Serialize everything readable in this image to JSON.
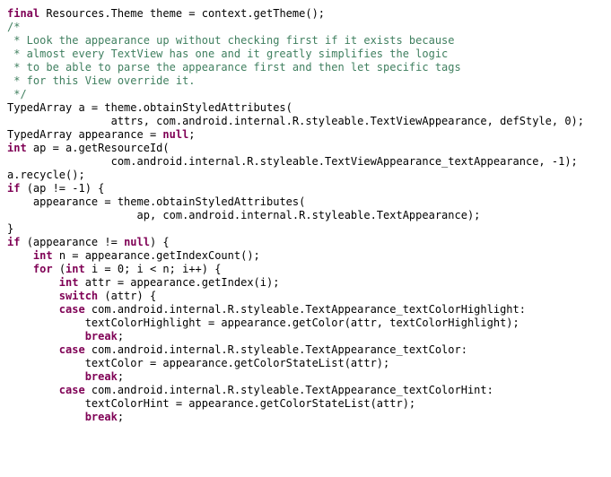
{
  "lines": [
    {
      "indent": 0,
      "parts": [
        {
          "t": "final ",
          "c": "kw"
        },
        {
          "t": "Resources.Theme theme = context.getTheme();"
        }
      ]
    },
    {
      "indent": 0,
      "parts": [
        {
          "t": ""
        }
      ]
    },
    {
      "indent": 0,
      "parts": [
        {
          "t": "/*",
          "c": "cmt"
        }
      ]
    },
    {
      "indent": 0,
      "parts": [
        {
          "t": " * Look the appearance up without checking first if it exists because",
          "c": "cmt"
        }
      ]
    },
    {
      "indent": 0,
      "parts": [
        {
          "t": " * almost every TextView has one and it greatly simplifies the logic",
          "c": "cmt"
        }
      ]
    },
    {
      "indent": 0,
      "parts": [
        {
          "t": " * to be able to parse the appearance first and then let specific tags",
          "c": "cmt"
        }
      ]
    },
    {
      "indent": 0,
      "parts": [
        {
          "t": " * for this View override it.",
          "c": "cmt"
        }
      ]
    },
    {
      "indent": 0,
      "parts": [
        {
          "t": " */",
          "c": "cmt"
        }
      ]
    },
    {
      "indent": 0,
      "parts": [
        {
          "t": "TypedArray a = theme.obtainStyledAttributes("
        }
      ]
    },
    {
      "indent": 16,
      "parts": [
        {
          "t": "attrs, com.android.internal.R.styleable.TextViewAppearance, defStyle, 0);"
        }
      ]
    },
    {
      "indent": 0,
      "parts": [
        {
          "t": "TypedArray appearance = "
        },
        {
          "t": "null",
          "c": "kw"
        },
        {
          "t": ";"
        }
      ]
    },
    {
      "indent": 0,
      "parts": [
        {
          "t": "int ",
          "c": "kw"
        },
        {
          "t": "ap = a.getResourceId("
        }
      ]
    },
    {
      "indent": 16,
      "parts": [
        {
          "t": "com.android.internal.R.styleable.TextViewAppearance_textAppearance, -1);"
        }
      ]
    },
    {
      "indent": 0,
      "parts": [
        {
          "t": "a.recycle();"
        }
      ]
    },
    {
      "indent": 0,
      "parts": [
        {
          "t": "if ",
          "c": "kw"
        },
        {
          "t": "(ap != -1) {"
        }
      ]
    },
    {
      "indent": 4,
      "parts": [
        {
          "t": "appearance = theme.obtainStyledAttributes("
        }
      ]
    },
    {
      "indent": 20,
      "parts": [
        {
          "t": "ap, com.android.internal.R.styleable.TextAppearance);"
        }
      ]
    },
    {
      "indent": 0,
      "parts": [
        {
          "t": "}"
        }
      ]
    },
    {
      "indent": 0,
      "parts": [
        {
          "t": "if ",
          "c": "kw"
        },
        {
          "t": "(appearance != "
        },
        {
          "t": "null",
          "c": "kw"
        },
        {
          "t": ") {"
        }
      ]
    },
    {
      "indent": 4,
      "parts": [
        {
          "t": "int ",
          "c": "kw"
        },
        {
          "t": "n = appearance.getIndexCount();"
        }
      ]
    },
    {
      "indent": 4,
      "parts": [
        {
          "t": "for ",
          "c": "kw"
        },
        {
          "t": "("
        },
        {
          "t": "int ",
          "c": "kw"
        },
        {
          "t": "i = 0; i < n; i++) {"
        }
      ]
    },
    {
      "indent": 8,
      "parts": [
        {
          "t": "int ",
          "c": "kw"
        },
        {
          "t": "attr = appearance.getIndex(i);"
        }
      ]
    },
    {
      "indent": 0,
      "parts": [
        {
          "t": ""
        }
      ]
    },
    {
      "indent": 8,
      "parts": [
        {
          "t": "switch ",
          "c": "kw"
        },
        {
          "t": "(attr) {"
        }
      ]
    },
    {
      "indent": 8,
      "parts": [
        {
          "t": "case ",
          "c": "kw"
        },
        {
          "t": "com.android.internal.R.styleable.TextAppearance_textColorHighlight:"
        }
      ]
    },
    {
      "indent": 12,
      "parts": [
        {
          "t": "textColorHighlight = appearance.getColor(attr, textColorHighlight);"
        }
      ]
    },
    {
      "indent": 12,
      "parts": [
        {
          "t": "break",
          "c": "kw"
        },
        {
          "t": ";"
        }
      ]
    },
    {
      "indent": 0,
      "parts": [
        {
          "t": ""
        }
      ]
    },
    {
      "indent": 8,
      "parts": [
        {
          "t": "case ",
          "c": "kw"
        },
        {
          "t": "com.android.internal.R.styleable.TextAppearance_textColor:"
        }
      ]
    },
    {
      "indent": 12,
      "parts": [
        {
          "t": "textColor = appearance.getColorStateList(attr);"
        }
      ]
    },
    {
      "indent": 12,
      "parts": [
        {
          "t": "break",
          "c": "kw"
        },
        {
          "t": ";"
        }
      ]
    },
    {
      "indent": 0,
      "parts": [
        {
          "t": ""
        }
      ]
    },
    {
      "indent": 8,
      "parts": [
        {
          "t": "case ",
          "c": "kw"
        },
        {
          "t": "com.android.internal.R.styleable.TextAppearance_textColorHint:"
        }
      ]
    },
    {
      "indent": 12,
      "parts": [
        {
          "t": "textColorHint = appearance.getColorStateList(attr);"
        }
      ]
    },
    {
      "indent": 12,
      "parts": [
        {
          "t": "break",
          "c": "kw"
        },
        {
          "t": ";"
        }
      ]
    }
  ]
}
